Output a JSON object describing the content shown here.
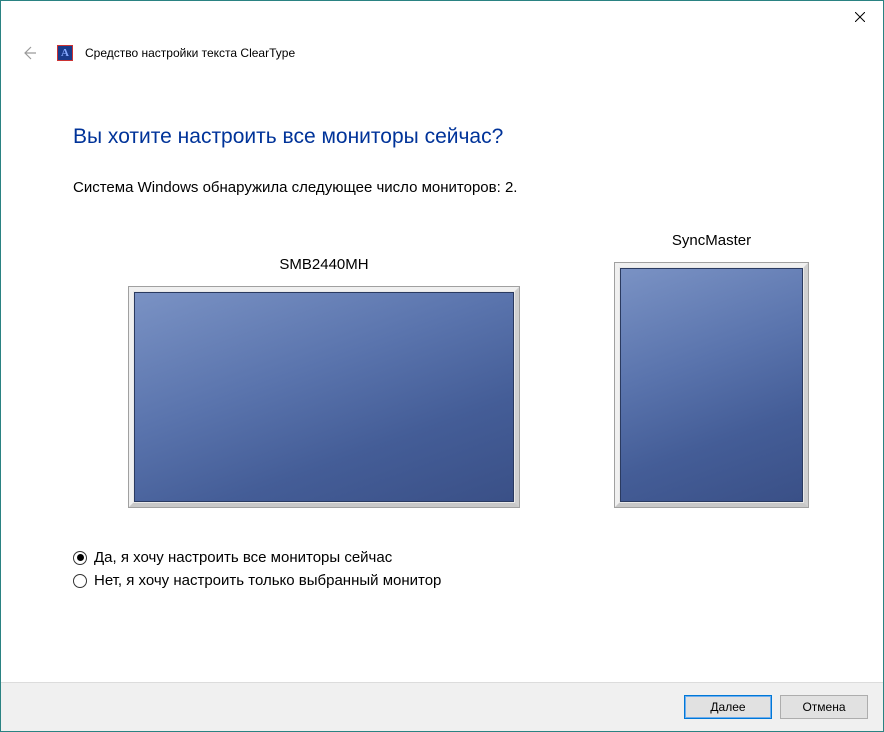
{
  "window": {
    "app_title": "Средство настройки текста ClearType"
  },
  "page": {
    "heading": "Вы хотите настроить все мониторы сейчас?",
    "subtext": "Система Windows обнаружила следующее число мониторов: 2."
  },
  "monitors": [
    {
      "label": "SMB2440MH"
    },
    {
      "label": "SyncMaster"
    }
  ],
  "options": {
    "tune_all": "Да, я хочу настроить все мониторы сейчас",
    "tune_selected": "Нет, я хочу настроить только выбранный монитор",
    "selected": "tune_all"
  },
  "buttons": {
    "next": "Далее",
    "cancel": "Отмена"
  }
}
